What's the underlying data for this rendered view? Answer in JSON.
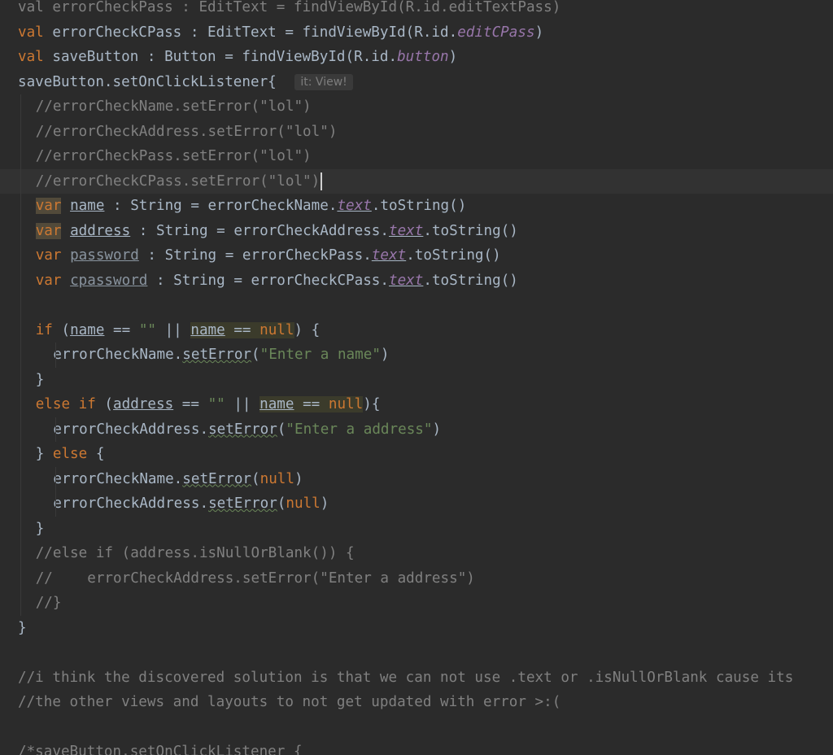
{
  "editor": {
    "lines": [
      {
        "tokens": [
          {
            "t": "val errorCheckPass : EditText = findViewById(R.id.editTextPass)",
            "c": "cm"
          }
        ]
      },
      {
        "tokens": [
          {
            "t": "val",
            "c": "kw"
          },
          {
            "t": " errorCheckCPass : EditText = findViewById(R.id."
          },
          {
            "t": "editCPass",
            "c": "prop"
          },
          {
            "t": ")"
          }
        ]
      },
      {
        "tokens": [
          {
            "t": "val",
            "c": "kw"
          },
          {
            "t": " saveButton : Button = findViewById(R.id."
          },
          {
            "t": "button",
            "c": "prop"
          },
          {
            "t": ")"
          }
        ]
      },
      {
        "tokens": [
          {
            "t": "saveButton.setOnClickListener{ "
          },
          {
            "t": "it: View!",
            "c": "hint"
          }
        ]
      },
      {
        "indent": 2,
        "tokens": [
          {
            "t": "//errorCheckName.setError(\"lol\")",
            "c": "cm"
          }
        ]
      },
      {
        "indent": 2,
        "tokens": [
          {
            "t": "//errorCheckAddress.setError(\"lol\")",
            "c": "cm"
          }
        ]
      },
      {
        "indent": 2,
        "tokens": [
          {
            "t": "//errorCheckPass.setError(\"lol\")",
            "c": "cm"
          }
        ]
      },
      {
        "indent": 2,
        "current": true,
        "tokens": [
          {
            "t": "//errorCheckCPass.setError(\"lol\")",
            "c": "cm"
          },
          {
            "t": "",
            "c": "caret"
          }
        ]
      },
      {
        "indent": 2,
        "tokens": [
          {
            "t": "var",
            "c": "kw hl"
          },
          {
            "t": " "
          },
          {
            "t": "name",
            "c": "ul"
          },
          {
            "t": " : String = errorCheckName."
          },
          {
            "t": "text",
            "c": "prop ul"
          },
          {
            "t": ".toString()"
          }
        ]
      },
      {
        "indent": 2,
        "tokens": [
          {
            "t": "var",
            "c": "kw hl"
          },
          {
            "t": " "
          },
          {
            "t": "address",
            "c": "ul"
          },
          {
            "t": " : String = errorCheckAddress."
          },
          {
            "t": "text",
            "c": "prop ul"
          },
          {
            "t": ".toString()"
          }
        ]
      },
      {
        "indent": 2,
        "tokens": [
          {
            "t": "var",
            "c": "kw"
          },
          {
            "t": " "
          },
          {
            "t": "password",
            "c": "ul mutedv"
          },
          {
            "t": " : String = errorCheckPass."
          },
          {
            "t": "text",
            "c": "prop ul"
          },
          {
            "t": ".toString()"
          }
        ]
      },
      {
        "indent": 2,
        "tokens": [
          {
            "t": "var",
            "c": "kw"
          },
          {
            "t": " "
          },
          {
            "t": "cpassword",
            "c": "ul mutedv"
          },
          {
            "t": " : String = errorCheckCPass."
          },
          {
            "t": "text",
            "c": "prop ul"
          },
          {
            "t": ".toString()"
          }
        ]
      },
      {
        "tokens": []
      },
      {
        "indent": 2,
        "tokens": [
          {
            "t": "if",
            "c": "kw"
          },
          {
            "t": " ("
          },
          {
            "t": "name",
            "c": "ul"
          },
          {
            "t": " == "
          },
          {
            "t": "\"\"",
            "c": "str"
          },
          {
            "t": " || "
          },
          {
            "t": "name",
            "c": "ul hl2"
          },
          {
            "t": " == ",
            "c": "hl2"
          },
          {
            "t": "null",
            "c": "kw hl2"
          },
          {
            "t": ") {"
          }
        ]
      },
      {
        "indent": 4,
        "tokens": [
          {
            "t": "errorCheckName."
          },
          {
            "t": "setError",
            "c": "wl"
          },
          {
            "t": "("
          },
          {
            "t": "\"Enter a name\"",
            "c": "str"
          },
          {
            "t": ")"
          }
        ]
      },
      {
        "indent": 2,
        "tokens": [
          {
            "t": "}"
          }
        ]
      },
      {
        "indent": 2,
        "tokens": [
          {
            "t": "else if",
            "c": "kw"
          },
          {
            "t": " ("
          },
          {
            "t": "address",
            "c": "ul"
          },
          {
            "t": " == "
          },
          {
            "t": "\"\"",
            "c": "str"
          },
          {
            "t": " || "
          },
          {
            "t": "name",
            "c": "ul hl2"
          },
          {
            "t": " == ",
            "c": "hl2"
          },
          {
            "t": "null",
            "c": "kw hl2"
          },
          {
            "t": "){"
          }
        ]
      },
      {
        "indent": 4,
        "tokens": [
          {
            "t": "errorCheckAddress."
          },
          {
            "t": "setError",
            "c": "wl"
          },
          {
            "t": "("
          },
          {
            "t": "\"Enter a address\"",
            "c": "str"
          },
          {
            "t": ")"
          }
        ]
      },
      {
        "indent": 2,
        "tokens": [
          {
            "t": "} "
          },
          {
            "t": "else",
            "c": "kw"
          },
          {
            "t": " {"
          }
        ]
      },
      {
        "indent": 4,
        "tokens": [
          {
            "t": "errorCheckName."
          },
          {
            "t": "setError",
            "c": "wl"
          },
          {
            "t": "("
          },
          {
            "t": "null",
            "c": "kw"
          },
          {
            "t": ")"
          }
        ]
      },
      {
        "indent": 4,
        "tokens": [
          {
            "t": "errorCheckAddress."
          },
          {
            "t": "setError",
            "c": "wl"
          },
          {
            "t": "("
          },
          {
            "t": "null",
            "c": "kw"
          },
          {
            "t": ")"
          }
        ]
      },
      {
        "indent": 2,
        "tokens": [
          {
            "t": "}"
          }
        ]
      },
      {
        "indent": 2,
        "tokens": [
          {
            "t": "//else if (address.isNullOrBlank()) {",
            "c": "cm"
          }
        ]
      },
      {
        "indent": 2,
        "tokens": [
          {
            "t": "//    errorCheckAddress.setError(\"Enter a address\")",
            "c": "cm"
          }
        ]
      },
      {
        "indent": 2,
        "tokens": [
          {
            "t": "//}",
            "c": "cm"
          }
        ]
      },
      {
        "tokens": [
          {
            "t": "}"
          }
        ]
      },
      {
        "tokens": []
      },
      {
        "tokens": [
          {
            "t": "//i think the discovered solution is that we can not use .text or .isNullOrBlank cause its",
            "c": "cm"
          }
        ]
      },
      {
        "tokens": [
          {
            "t": "//the other views and layouts to not get updated with error >:(",
            "c": "cm"
          }
        ]
      },
      {
        "tokens": []
      },
      {
        "tokens": [
          {
            "t": "/*saveButton.setOnClickListener {",
            "c": "cm"
          }
        ]
      }
    ]
  }
}
